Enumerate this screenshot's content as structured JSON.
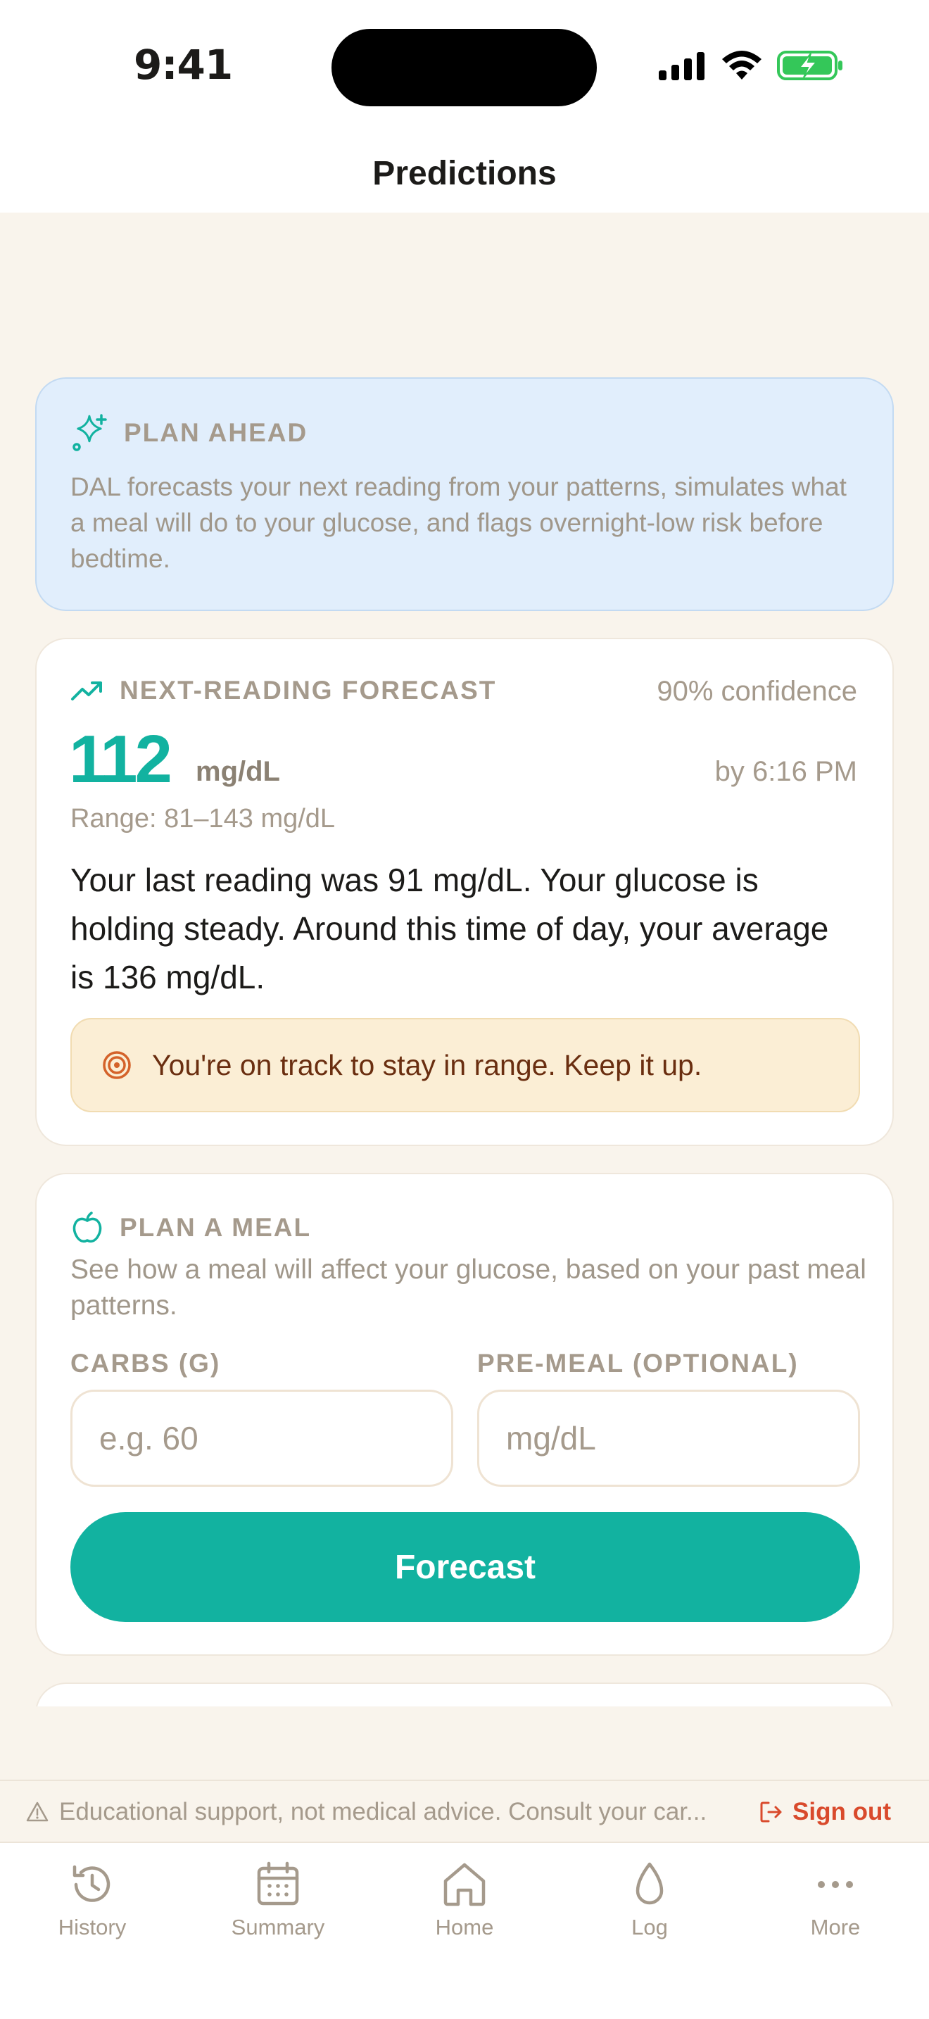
{
  "status": {
    "time": "9:41"
  },
  "nav": {
    "title": "Predictions"
  },
  "plan_ahead": {
    "label": "PLAN AHEAD",
    "text": "DAL forecasts your next reading from your patterns, simulates what a meal will do to your glucose, and flags overnight-low risk before bedtime."
  },
  "forecast": {
    "label": "NEXT-READING FORECAST",
    "confidence": "90% confidence",
    "value": "112",
    "unit": "mg/dL",
    "by_time": "by 6:16 PM",
    "range": "Range: 81–143 mg/dL",
    "summary": "Your last reading was 91 mg/dL. Your glucose is holding steady. Around this time of day, your average is 136 mg/dL.",
    "status_message": "You're on track to stay in range. Keep it up."
  },
  "meal": {
    "label": "PLAN A MEAL",
    "description": "See how a meal will affect your glucose, based on your past meal patterns.",
    "carbs_label": "CARBS (G)",
    "carbs_placeholder": "e.g. 60",
    "premeal_label": "PRE-MEAL (OPTIONAL)",
    "premeal_placeholder": "mg/dL",
    "button": "Forecast"
  },
  "footer": {
    "disclaimer": "Educational support, not medical advice. Consult your car...",
    "signout": "Sign out"
  },
  "tabs": [
    {
      "label": "History",
      "icon": "history-icon"
    },
    {
      "label": "Summary",
      "icon": "calendar-icon"
    },
    {
      "label": "Home",
      "icon": "home-icon"
    },
    {
      "label": "Log",
      "icon": "drop-icon"
    },
    {
      "label": "More",
      "icon": "more-icon"
    }
  ],
  "colors": {
    "accent": "#12b2a0",
    "background": "#f9f4ec",
    "info_bg": "#e1eefc",
    "warning_bg": "#fbeed5",
    "signout": "#d94a2c"
  }
}
